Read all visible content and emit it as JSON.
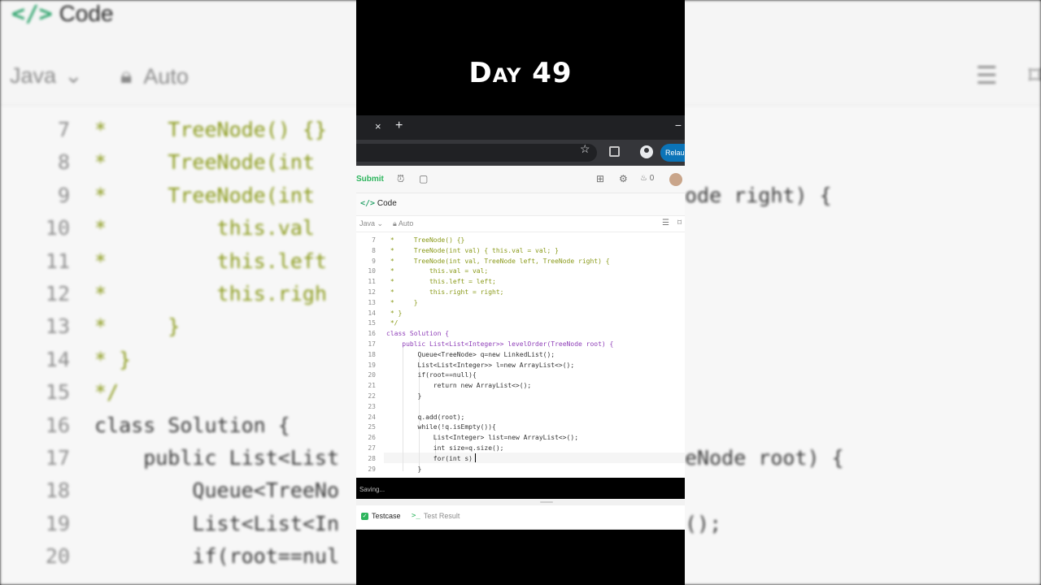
{
  "overlay": {
    "title": "Day 49"
  },
  "browser": {
    "new_tab": "+",
    "close_tab": "×",
    "minimize": "−",
    "relaunch": "Relaun"
  },
  "toolbar": {
    "submit": "Submit",
    "streak": "0"
  },
  "panel": {
    "title_icon": "</>",
    "title": "Code",
    "language": "Java",
    "mode": "Auto"
  },
  "editor": {
    "lines": [
      {
        "n": "7",
        "t": " *     TreeNode() {}"
      },
      {
        "n": "8",
        "t": " *     TreeNode(int val) { this.val = val; }"
      },
      {
        "n": "9",
        "t": " *     TreeNode(int val, TreeNode left, TreeNode right) {"
      },
      {
        "n": "10",
        "t": " *         this.val = val;"
      },
      {
        "n": "11",
        "t": " *         this.left = left;"
      },
      {
        "n": "12",
        "t": " *         this.right = right;"
      },
      {
        "n": "13",
        "t": " *     }"
      },
      {
        "n": "14",
        "t": " * }"
      },
      {
        "n": "15",
        "t": " */"
      },
      {
        "n": "16",
        "t": "class Solution {"
      },
      {
        "n": "17",
        "t": "    public List<List<Integer>> levelOrder(TreeNode root) {"
      },
      {
        "n": "18",
        "t": "        Queue<TreeNode> q=new LinkedList();"
      },
      {
        "n": "19",
        "t": "        List<List<Integer>> l=new ArrayList<>();"
      },
      {
        "n": "20",
        "t": "        if(root==null){"
      },
      {
        "n": "21",
        "t": "            return new ArrayList<>();"
      },
      {
        "n": "22",
        "t": "        }"
      },
      {
        "n": "23",
        "t": ""
      },
      {
        "n": "24",
        "t": "        q.add(root);"
      },
      {
        "n": "25",
        "t": "        while(!q.isEmpty()){"
      },
      {
        "n": "26",
        "t": "            List<Integer> list=new ArrayList<>();"
      },
      {
        "n": "27",
        "t": "            int size=q.size();"
      },
      {
        "n": "28",
        "t": "            for(int s)"
      },
      {
        "n": "29",
        "t": "        }"
      }
    ],
    "status": "Saving..."
  },
  "bottom_tabs": {
    "testcase": "Testcase",
    "test_result": "Test Result",
    "test_result_icon": ">_"
  },
  "background": {
    "title_icon": "</>",
    "title": "Code",
    "language": "Java",
    "mode": "Auto",
    "lines": [
      {
        "n": "7",
        "t": "*     TreeNode() {}"
      },
      {
        "n": "8",
        "t": "*     TreeNode(int"
      },
      {
        "n": "9",
        "t": "*     TreeNode(int"
      },
      {
        "n": "10",
        "t": "*         this.val"
      },
      {
        "n": "11",
        "t": "*         this.left"
      },
      {
        "n": "12",
        "t": "*         this.righ"
      },
      {
        "n": "13",
        "t": "*     }"
      },
      {
        "n": "14",
        "t": "* }"
      },
      {
        "n": "15",
        "t": "*/"
      },
      {
        "n": "16",
        "t": "class Solution {"
      },
      {
        "n": "17",
        "t": "    public List<List"
      },
      {
        "n": "18",
        "t": "        Queue<TreeNo"
      },
      {
        "n": "19",
        "t": "        List<List<In"
      },
      {
        "n": "20",
        "t": "        if(root==nul"
      }
    ],
    "right_fragments": [
      {
        "line": "9",
        "t": "ode right) {"
      },
      {
        "line": "17",
        "t": "eNode root) {"
      },
      {
        "line": "19",
        "t": "();"
      }
    ]
  },
  "colors": {
    "accent_green": "#2db55d",
    "relaunch_blue": "#0b74b8",
    "keyword": "#8f3fb8",
    "type": "#2b7a78",
    "comment": "#8a9a1a"
  }
}
